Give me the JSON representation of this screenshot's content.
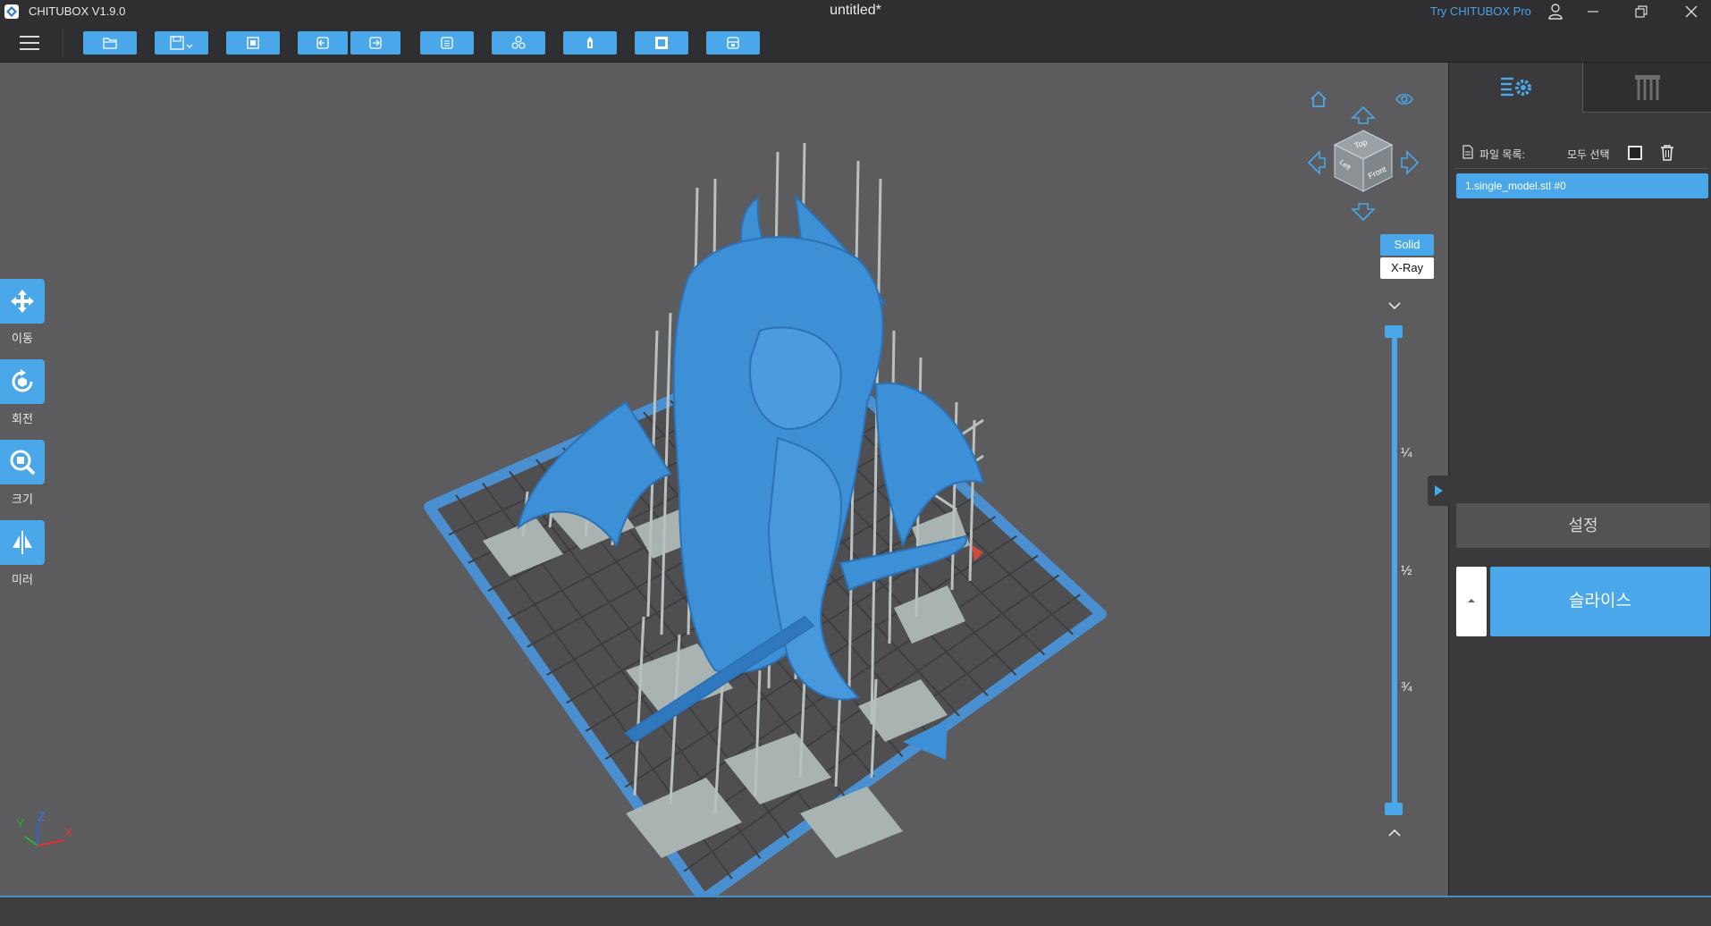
{
  "window": {
    "app_name": "CHITUBOX V1.9.0",
    "document_title": "untitled*",
    "promo_link": "Try CHITUBOX Pro"
  },
  "toolbar": {
    "buttons": [
      {
        "name": "open-file",
        "icon": "folder-icon"
      },
      {
        "name": "save",
        "icon": "save-icon"
      },
      {
        "name": "screenshot",
        "icon": "screenshot-icon"
      },
      {
        "name": "undo",
        "icon": "undo-icon"
      },
      {
        "name": "redo",
        "icon": "redo-icon"
      },
      {
        "name": "layout",
        "icon": "layout-icon"
      },
      {
        "name": "arrange",
        "icon": "arrange-icon"
      },
      {
        "name": "hollow",
        "icon": "hollow-icon"
      },
      {
        "name": "dig-hole",
        "icon": "hole-icon"
      },
      {
        "name": "print",
        "icon": "print-icon"
      }
    ]
  },
  "left_tools": [
    {
      "label": "이동",
      "icon": "move-icon"
    },
    {
      "label": "회전",
      "icon": "rotate-icon"
    },
    {
      "label": "크기",
      "icon": "scale-icon"
    },
    {
      "label": "미러",
      "icon": "mirror-icon"
    }
  ],
  "view_cube": {
    "top_label": "Top",
    "front_label": "Front",
    "left_label": "Left"
  },
  "render_modes": {
    "solid": "Solid",
    "xray": "X-Ray",
    "active": "Solid"
  },
  "layer_slider": {
    "marks": [
      "¼",
      "½",
      "¾"
    ]
  },
  "axes": {
    "x": "X",
    "y": "Y",
    "z": "Z"
  },
  "right_panel": {
    "tabs": [
      {
        "name": "settings-tab",
        "icon": "settings-list-icon",
        "active": true
      },
      {
        "name": "support-tab",
        "icon": "support-icon",
        "active": false
      }
    ],
    "file_list_label": "파일 목록:",
    "select_all_label": "모두 선택",
    "files": [
      "1.single_model.stl #0"
    ],
    "settings_button": "설정",
    "slice_button": "슬라이스"
  },
  "colors": {
    "accent": "#49a7ea",
    "model": "#3d8fd6",
    "viewport_bg": "#5c5c5e",
    "panel_bg": "#3a3a3c",
    "support": "#a8b0b0"
  }
}
